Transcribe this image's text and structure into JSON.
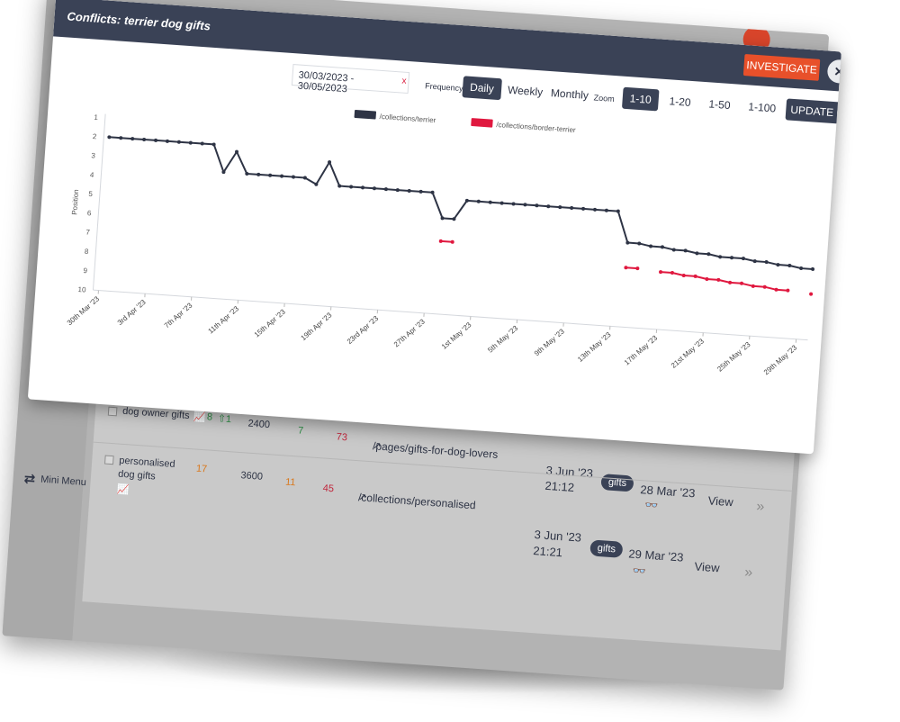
{
  "modal": {
    "title": "Conflicts: terrier dog gifts",
    "investigate_label": "INVESTIGATE",
    "close_glyph": "×"
  },
  "controls": {
    "date_range": "30/03/2023 - 30/05/2023",
    "date_clear": "x",
    "frequency_label": "Frequency",
    "frequency_options": [
      "Daily",
      "Weekly",
      "Monthly"
    ],
    "frequency_selected": "Daily",
    "zoom_label": "Zoom",
    "zoom_options": [
      "1-10",
      "1-20",
      "1-50",
      "1-100"
    ],
    "zoom_selected": "1-10",
    "update_label": "UPDATE GRAPH"
  },
  "chart_data": {
    "type": "line",
    "ylabel": "Position",
    "ylim": [
      1,
      10
    ],
    "y_inverted": true,
    "y_ticks": [
      1,
      2,
      3,
      4,
      5,
      6,
      7,
      8,
      9,
      10
    ],
    "x_tick_labels": [
      "30th Mar '23",
      "3rd Apr '23",
      "7th Apr '23",
      "11th Apr '23",
      "15th Apr '23",
      "19th Apr '23",
      "23rd Apr '23",
      "27th Apr '23",
      "1st May '23",
      "5th May '23",
      "9th May '23",
      "13th May '23",
      "17th May '23",
      "21st May '23",
      "25th May '23",
      "29th May '23"
    ],
    "legend_position": "top-center",
    "series": [
      {
        "name": "/collections/terrier",
        "color": "#2e3445",
        "values": [
          2,
          2,
          2,
          2,
          2,
          2,
          2,
          2,
          2,
          2,
          3.4,
          2.3,
          3.4,
          3.4,
          3.4,
          3.4,
          3.4,
          3.4,
          3.7,
          2.5,
          3.7,
          3.7,
          3.7,
          3.7,
          3.7,
          3.7,
          3.7,
          3.7,
          3.7,
          5,
          5,
          4,
          4,
          4,
          4,
          4,
          4,
          4,
          4,
          4,
          4,
          4,
          4,
          4,
          4,
          5.6,
          5.6,
          5.7,
          5.7,
          5.8,
          5.8,
          5.9,
          5.9,
          6,
          6,
          6,
          6.1,
          6.1,
          6.2,
          6.2,
          6.3,
          6.3
        ]
      },
      {
        "name": "/collections/border-terrier",
        "color": "#e0183f",
        "values": [
          null,
          null,
          null,
          null,
          null,
          null,
          null,
          null,
          null,
          null,
          null,
          null,
          null,
          null,
          null,
          null,
          null,
          null,
          null,
          null,
          null,
          null,
          null,
          null,
          null,
          null,
          null,
          null,
          null,
          6.2,
          6.2,
          null,
          null,
          null,
          null,
          null,
          null,
          null,
          null,
          null,
          null,
          null,
          null,
          null,
          null,
          6.9,
          6.9,
          null,
          7,
          7,
          7.1,
          7.1,
          7.2,
          7.2,
          7.3,
          7.3,
          7.4,
          7.4,
          7.5,
          7.5,
          null,
          7.6
        ]
      }
    ]
  },
  "background_table": {
    "menu_label": "Mini Menu",
    "rows": [
      {
        "keyword": "dog owner gifts",
        "rank": "8",
        "change": "⇧1",
        "volume": "2400",
        "col_a": "7",
        "col_b": "73",
        "url": "/pages/gifts-for-dog-lovers",
        "date": "3 Jun '23",
        "time": "21:12",
        "tag": "gifts",
        "first_seen": "28 Mar '23",
        "action": "View"
      },
      {
        "keyword": "personalised dog gifts",
        "rank": "17",
        "change": "",
        "volume": "3600",
        "col_a": "11",
        "col_b": "45",
        "url": "/collections/personalised",
        "date": "3 Jun '23",
        "time": "21:21",
        "tag": "gifts",
        "first_seen": "29 Mar '23",
        "action": "View"
      }
    ]
  }
}
